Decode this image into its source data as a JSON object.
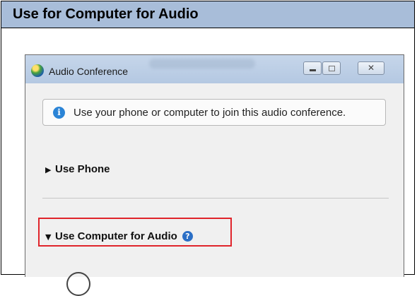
{
  "header": {
    "title": "Use for Computer for Audio"
  },
  "window": {
    "title": "Audio Conference",
    "controls": {
      "minimize": "",
      "maximize": "",
      "close": "✕"
    }
  },
  "info": {
    "icon_name": "info-icon",
    "icon_glyph": "i",
    "text": "Use your phone or computer to join this audio conference."
  },
  "sections": {
    "phone": {
      "arrow": "▶",
      "label": "Use Phone",
      "expanded": false
    },
    "computer": {
      "arrow": "▼",
      "label": "Use Computer for Audio",
      "expanded": true,
      "help_glyph": "?"
    }
  },
  "colors": {
    "header_bg": "#a8bdd9",
    "highlight": "#e0242b",
    "info_blue": "#2b84d6"
  }
}
